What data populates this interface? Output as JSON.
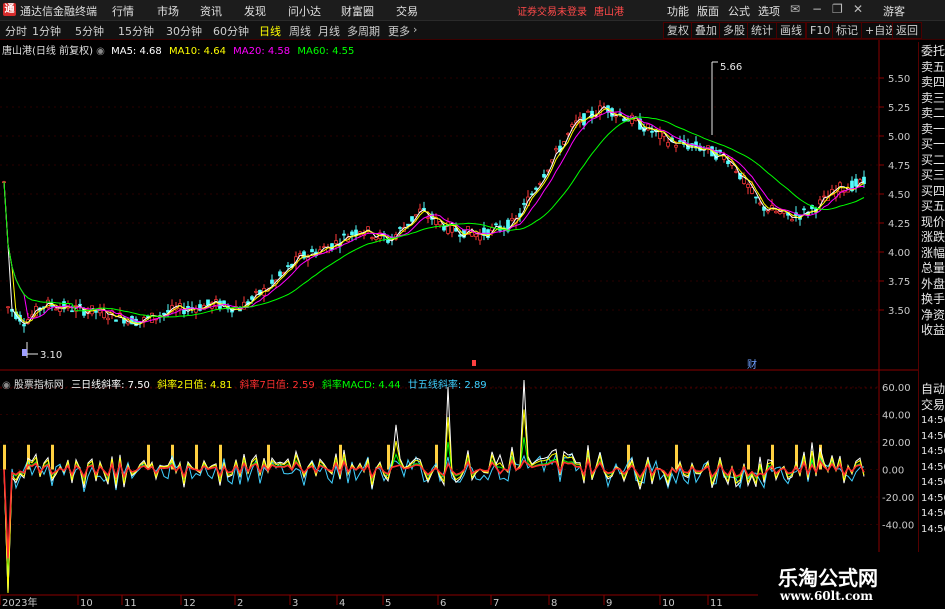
{
  "titlebar": {
    "app_name": "通达信金融终端",
    "menus": [
      "行情",
      "市场",
      "资讯",
      "发现",
      "问小达",
      "财富圈",
      "交易"
    ],
    "notice": "证券交易未登录",
    "stock_name": "唐山港",
    "right_menus": [
      "功能",
      "版面",
      "公式",
      "选项"
    ],
    "guest": "游客"
  },
  "toolbar": {
    "periods": [
      "分时",
      "1分钟",
      "5分钟",
      "15分钟",
      "30分钟",
      "60分钟",
      "日线",
      "周线",
      "月线",
      "多周期",
      "更多"
    ],
    "active_period": "日线",
    "buttons": [
      "复权",
      "叠加",
      "多股",
      "统计",
      "画线",
      "F10",
      "标记",
      "+自选",
      "返回"
    ]
  },
  "main_chart": {
    "title": "唐山港(日线 前复权)",
    "ma": [
      {
        "label": "MA5: 4.68",
        "color": "#ffffff"
      },
      {
        "label": "MA10: 4.64",
        "color": "#ffff00"
      },
      {
        "label": "MA20: 4.58",
        "color": "#ff00ff"
      },
      {
        "label": "MA60: 4.55",
        "color": "#00ff00"
      }
    ],
    "y_ticks": [
      "5.50",
      "5.25",
      "5.00",
      "4.75",
      "4.50",
      "4.25",
      "4.00",
      "3.75",
      "3.50"
    ],
    "high_label": "5.66",
    "low_label": "3.10",
    "marker_cai": "财"
  },
  "sub_chart": {
    "title": "股票指标网",
    "items": [
      {
        "label": "三日线斜率: 7.50",
        "color": "#ffffff"
      },
      {
        "label": "斜率2日值: 4.81",
        "color": "#ffff00"
      },
      {
        "label": "斜率7日值: 2.59",
        "color": "#ff3030"
      },
      {
        "label": "斜率MACD: 4.44",
        "color": "#00ff00"
      },
      {
        "label": "廿五线斜率: 2.89",
        "color": "#40d0ff"
      }
    ],
    "y_ticks": [
      "60.00",
      "40.00",
      "20.00",
      "0.00",
      "-20.00",
      "-40.00"
    ]
  },
  "x_axis": [
    "2023年",
    "10",
    "11",
    "12",
    "2",
    "3",
    "4",
    "5",
    "6",
    "7",
    "8",
    "9",
    "10",
    "11"
  ],
  "right_panel": [
    "委托",
    "卖五",
    "卖四",
    "卖三",
    "卖二",
    "卖一",
    "买一",
    "买二",
    "买三",
    "买四",
    "买五",
    "现价",
    "涨跌",
    "涨幅",
    "总量",
    "外盘",
    "换手",
    "净资",
    "收益"
  ],
  "right_panel_sub": [
    "自动",
    "交易",
    "14:50",
    "14:50",
    "14:50",
    "14:50",
    "14:50",
    "14:50",
    "14:50",
    "14:50"
  ],
  "watermark": {
    "title": "乐淘公式网",
    "url": "www.60lt.com"
  }
}
